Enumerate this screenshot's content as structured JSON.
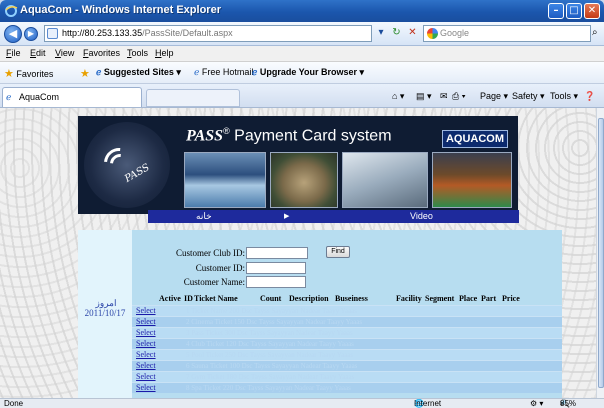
{
  "window": {
    "title": "AquaCom - Windows Internet Explorer",
    "minimize": "–",
    "maximize": "□",
    "close": "✕"
  },
  "addressbar": {
    "back": "◀",
    "forward": "▶",
    "url_host": "http://80.253.133.35",
    "url_path": "/PassSite/Default.aspx",
    "refresh": "↻",
    "stop": "✕",
    "search_placeholder": "Google",
    "search_icon": "⌕"
  },
  "menu": [
    "File",
    "Edit",
    "View",
    "Favorites",
    "Tools",
    "Help"
  ],
  "favorites": {
    "favorites_label": "Favorites",
    "suggested": "Suggested Sites ▾",
    "hotmail": "Free Hotmail",
    "upgrade": "Upgrade Your Browser ▾"
  },
  "tabs": {
    "active": "AquaCom",
    "commands": [
      "Page ▾",
      "Safety ▾",
      "Tools ▾"
    ]
  },
  "banner": {
    "brand": "PASS",
    "registered": "®",
    "title_rest": " Payment Card system",
    "partner": "AQUACOM"
  },
  "nav": {
    "home": "خانه",
    "arrow": "▶",
    "video": "Video"
  },
  "sidebar": {
    "today_label": "امروز",
    "date": "2011/10/17"
  },
  "form": {
    "club_id_label": "Customer Club ID:",
    "customer_id_label": "Customer ID:",
    "customer_name_label": "Customer Name:",
    "find_button": "Find"
  },
  "table": {
    "columns": [
      "Active",
      "ID",
      "Ticket Name",
      "Count",
      "Description",
      "Buseiness",
      "Facility",
      "Segment",
      "Place",
      "Part",
      "Price"
    ],
    "select_label": "Select",
    "rows": [
      {
        "ghost": "1   Ticket Name    200   Dsc    Tayss Sayayyan Nadear    Taayy    Yaaas"
      },
      {
        "ghost": "2   Cinema Ticket  150   Dsc    Tayss Sayayyan Nadear    Taayy    Yaaas"
      },
      {
        "ghost": "3   Pass Ticket    300   Dsc    Tayss Sayayyan Nadear    Taayy    Yaaas"
      },
      {
        "ghost": "4   Club Ticket    120   Dsc    Tayss Sayayyan Nadear    Taayy    Yaaas"
      },
      {
        "ghost": "5   Pool Ticket    250   Dsc    Tayss Sayayyan Nadear    Taayy    Yaaas"
      },
      {
        "ghost": "6   Sauna Ticket   100   Dsc    Tayss Sayayyan Nadear    Taayy    Yaaas"
      },
      {
        "ghost": "7   Gym Ticket     180   Dsc    Tayss Sayayyan Nadear    Taayy    Yaaas"
      },
      {
        "ghost": "8   Spa Ticket     220   Dsc    Tayss Sayayyan Nadear    Taayy    Yaaas"
      }
    ]
  },
  "statusbar": {
    "text": "Done",
    "zone": "Internet",
    "zoom": "85%"
  }
}
